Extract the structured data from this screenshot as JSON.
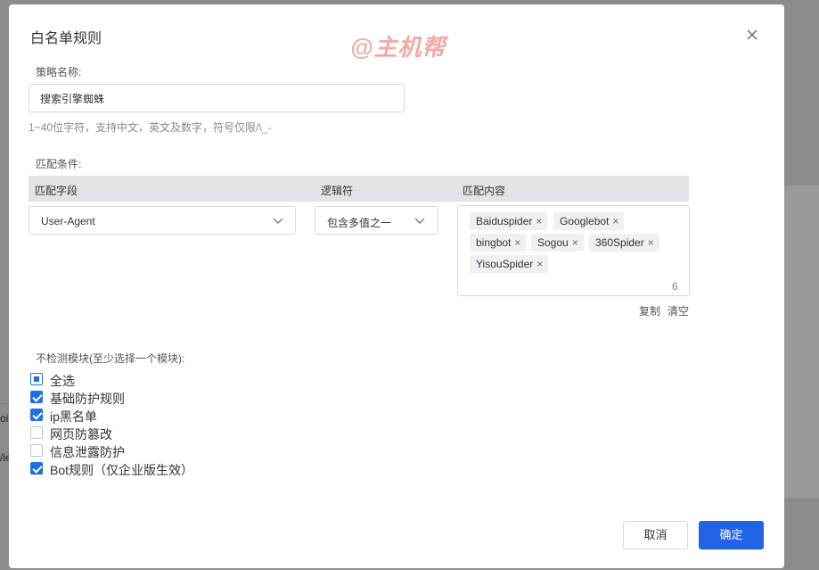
{
  "dialog": {
    "title": "白名单规则",
    "watermark": "@主机帮",
    "colors": {
      "primary": "#2264e5",
      "header_bg": "#e1e3e6"
    }
  },
  "policy": {
    "label": "策略名称:",
    "value": "搜索引擎蜘蛛",
    "hint": "1~40位字符，支持中文，英文及数字，符号仅限/\\_-"
  },
  "match": {
    "label": "匹配条件:",
    "columns": [
      "匹配字段",
      "逻辑符",
      "匹配内容"
    ],
    "field": "User-Agent",
    "operator": "包含多值之一",
    "tags": [
      "Baiduspider",
      "Googlebot",
      "bingbot",
      "Sogou",
      "360Spider",
      "YisouSpider"
    ],
    "count": "6",
    "copy": "复制",
    "clear": "清空"
  },
  "modules": {
    "label": "不检测模块(至少选择一个模块):",
    "select_all": {
      "label": "全选",
      "state": "partial"
    },
    "items": [
      {
        "label": "基础防护规则",
        "checked": true
      },
      {
        "label": "ip黑名单",
        "checked": true
      },
      {
        "label": "网页防篡改",
        "checked": false
      },
      {
        "label": "信息泄露防护",
        "checked": false
      },
      {
        "label": "Bot规则（仅企业版生效）",
        "checked": true
      }
    ]
  },
  "footer": {
    "cancel": "取消",
    "confirm": "确定"
  },
  "background": {
    "text1": "oi",
    "text2": "/ie"
  },
  "icons": {
    "close": "close-icon",
    "chevron": "chevron-down-icon",
    "tag_remove": "close-icon"
  }
}
